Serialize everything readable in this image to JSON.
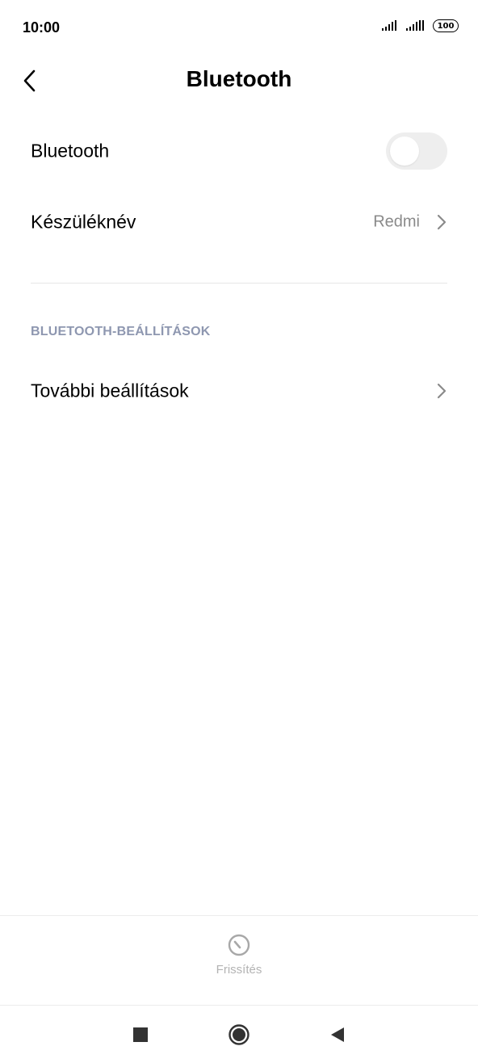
{
  "status_bar": {
    "time": "10:00",
    "battery": "100"
  },
  "header": {
    "title": "Bluetooth"
  },
  "rows": {
    "bluetooth": {
      "label": "Bluetooth",
      "toggle_on": false
    },
    "device_name": {
      "label": "Készüléknév",
      "value": "Redmi"
    },
    "more_settings": {
      "label": "További beállítások"
    }
  },
  "section": {
    "title": "BLUETOOTH-BEÁLLÍTÁSOK"
  },
  "refresh": {
    "label": "Frissítés"
  },
  "colors": {
    "section_header": "#8e97b0",
    "secondary_text": "#8a8a8a",
    "toggle_off_track": "#eeeeee",
    "refresh_text": "#b3b3b3"
  },
  "icons": {
    "back": "chevron-left-icon",
    "chevron": "chevron-right-icon",
    "refresh": "refresh-icon",
    "nav_recents": "square-icon",
    "nav_home": "circle-icon",
    "nav_back": "triangle-icon"
  }
}
